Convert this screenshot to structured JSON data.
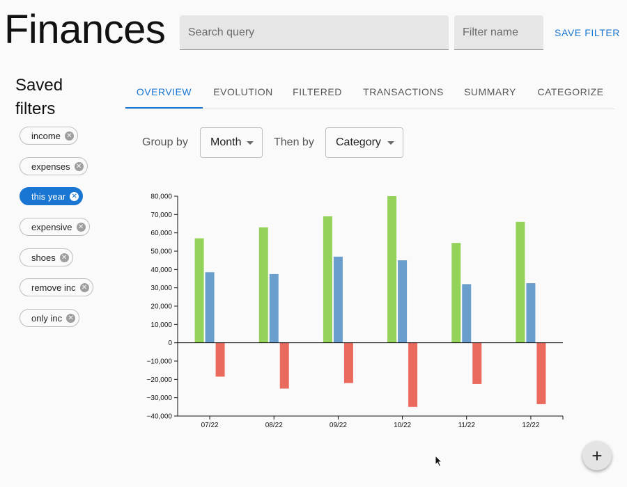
{
  "header": {
    "title": "Finances",
    "search_placeholder": "Search query",
    "filter_name_placeholder": "Filter name",
    "save_label": "SAVE FILTER"
  },
  "sidebar": {
    "title_line1": "Saved",
    "title_line2": "filters",
    "chips": [
      {
        "label": "income",
        "active": false
      },
      {
        "label": "expenses",
        "active": false
      },
      {
        "label": "this year",
        "active": true
      },
      {
        "label": "expensive",
        "active": false
      },
      {
        "label": "shoes",
        "active": false
      },
      {
        "label": "remove inc",
        "active": false
      },
      {
        "label": "only inc",
        "active": false
      }
    ]
  },
  "tabs": [
    "OVERVIEW",
    "EVOLUTION",
    "FILTERED",
    "TRANSACTIONS",
    "SUMMARY",
    "CATEGORIZE"
  ],
  "active_tab": "OVERVIEW",
  "controls": {
    "group_by_label": "Group by",
    "group_by_value": "Month",
    "then_by_label": "Then by",
    "then_by_value": "Category"
  },
  "colors": {
    "accent": "#1976d2",
    "series_green": "#95d25a",
    "series_blue": "#6a9fcd",
    "series_red": "#eb6a5e"
  },
  "fab_icon": "plus-icon",
  "chart_data": {
    "type": "bar",
    "title": "",
    "xlabel": "",
    "ylabel": "",
    "categories": [
      "07/22",
      "08/22",
      "09/22",
      "10/22",
      "11/22",
      "12/22"
    ],
    "ylim": [
      -40000,
      80000
    ],
    "yticks": [
      80000,
      70000,
      60000,
      50000,
      40000,
      30000,
      20000,
      10000,
      0,
      -10000,
      -20000,
      -30000,
      -40000
    ],
    "ytick_labels": [
      "80,000",
      "70,000",
      "60,000",
      "50,000",
      "40,000",
      "30,000",
      "20,000",
      "10,000",
      "0",
      "−10,000",
      "−20,000",
      "−30,000",
      "−40,000"
    ],
    "grid": false,
    "legend": "none",
    "series": [
      {
        "color": "#95d25a",
        "values": [
          57000,
          63000,
          69000,
          80000,
          54500,
          66000
        ]
      },
      {
        "color": "#6a9fcd",
        "values": [
          38500,
          37500,
          47000,
          45000,
          32000,
          32500
        ]
      },
      {
        "color": "#eb6a5e",
        "values": [
          -18500,
          -25000,
          -22000,
          -35000,
          -22500,
          -33500
        ]
      }
    ]
  }
}
